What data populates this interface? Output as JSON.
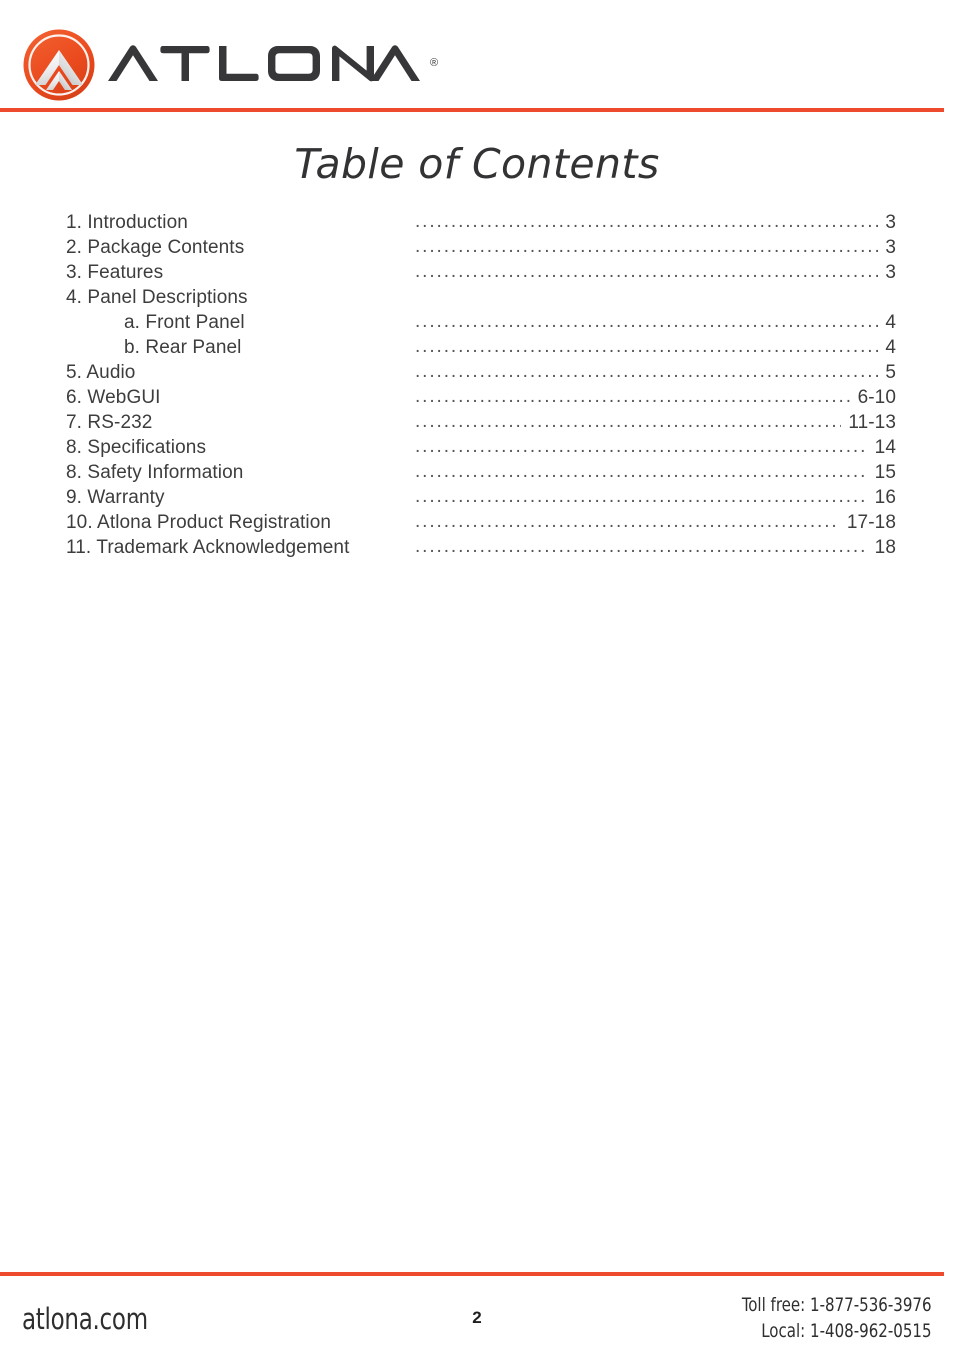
{
  "brand": {
    "name": "ATLONA",
    "registered_mark": "®",
    "logo_icon": "atlona-chevron-logo-icon",
    "accent_color": "#ee4b2e",
    "mark_colors": {
      "circle_outer": "#e8491f",
      "circle_inner": "#f05a2a",
      "chevron_light": "#f2f2f2",
      "chevron_shadow": "#d9d9d9"
    }
  },
  "page": {
    "title": "Table of Contents",
    "text_color": "#3d3d3f"
  },
  "toc": {
    "leader_char": ".",
    "entries": [
      {
        "label": "1. Introduction",
        "page": "3",
        "indent": false
      },
      {
        "label": "2. Package Contents",
        "page": "3",
        "indent": false
      },
      {
        "label": "3. Features",
        "page": "3",
        "indent": false
      },
      {
        "label": "4. Panel Descriptions",
        "page": "",
        "indent": false
      },
      {
        "label": "a. Front Panel",
        "page": "4",
        "indent": true
      },
      {
        "label": "b. Rear Panel",
        "page": "4",
        "indent": true
      },
      {
        "label": "5. Audio",
        "page": "5",
        "indent": false
      },
      {
        "label": "6. WebGUI",
        "page": "6-10",
        "indent": false
      },
      {
        "label": "7. RS-232",
        "page": "11-13",
        "indent": false
      },
      {
        "label": "8. Specifications",
        "page": "14",
        "indent": false
      },
      {
        "label": "8. Safety Information",
        "page": "15",
        "indent": false
      },
      {
        "label": "9. Warranty",
        "page": "16",
        "indent": false
      },
      {
        "label": "10. Atlona Product Registration",
        "page": "17-18",
        "indent": false
      },
      {
        "label": "11. Trademark Acknowledgement",
        "page": "18",
        "indent": false
      }
    ]
  },
  "footer": {
    "website": "atlona.com",
    "page_number": "2",
    "toll_free": "Toll free: 1-877-536-3976",
    "local": "Local: 1-408-962-0515"
  }
}
